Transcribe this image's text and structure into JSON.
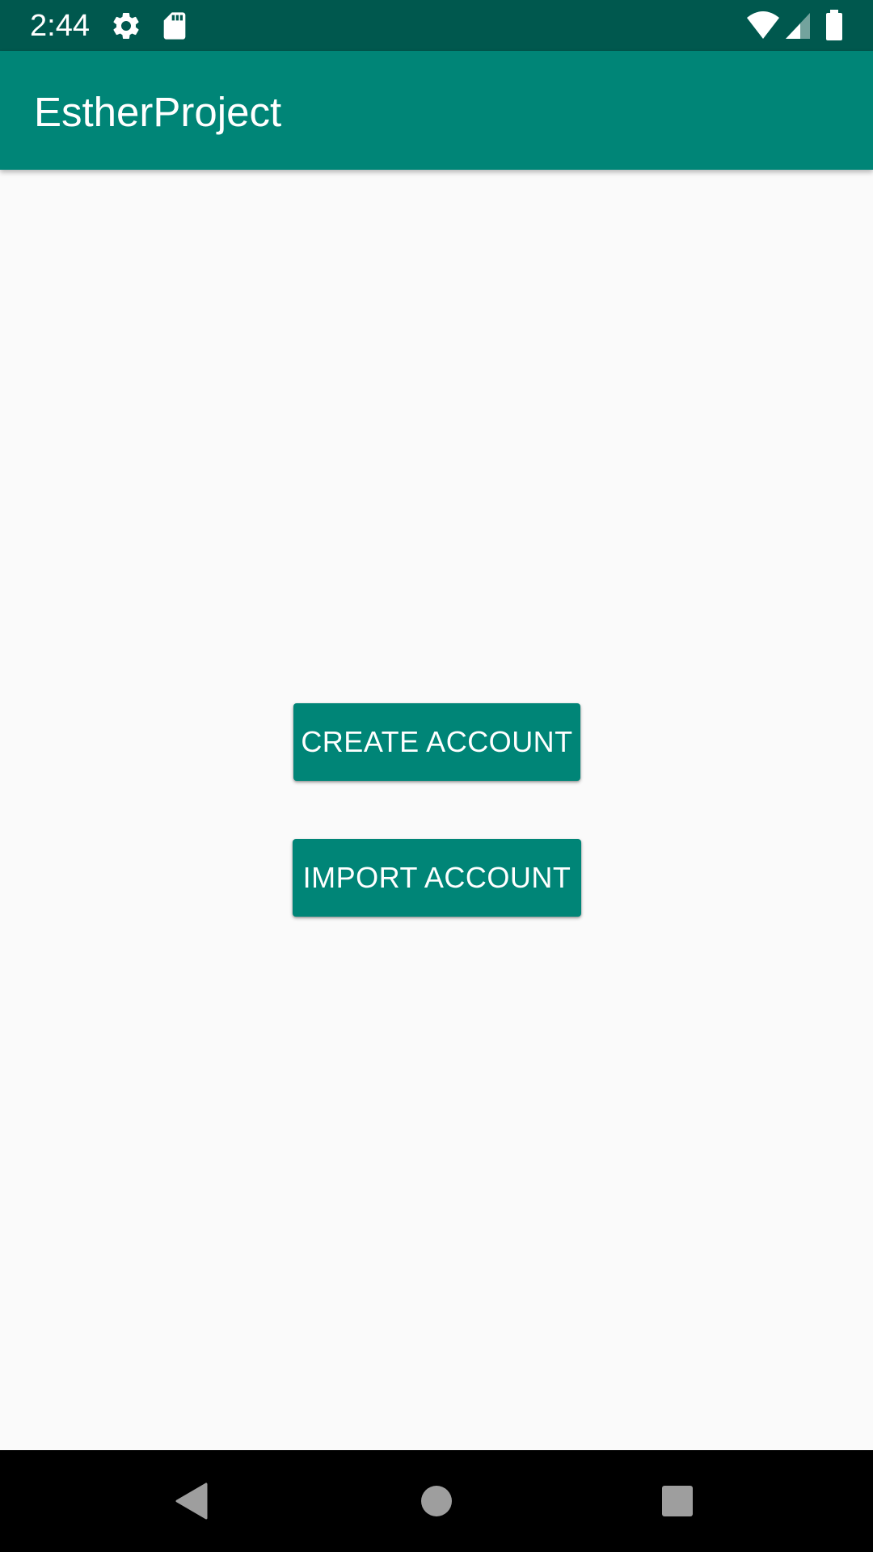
{
  "status_bar": {
    "time": "2:44",
    "icons": [
      "gear-icon",
      "sd-card-icon",
      "wifi-icon",
      "signal-icon",
      "battery-icon"
    ],
    "background": "#00584E"
  },
  "app_bar": {
    "title": "EstherProject",
    "background": "#008577"
  },
  "main": {
    "create_account_label": "CREATE ACCOUNT",
    "import_account_label": "IMPORT ACCOUNT",
    "button_color": "#008577",
    "background": "#FAFAFA"
  },
  "nav_bar": {
    "icons": [
      "back-icon",
      "home-icon",
      "recents-icon"
    ],
    "background": "#000000"
  }
}
